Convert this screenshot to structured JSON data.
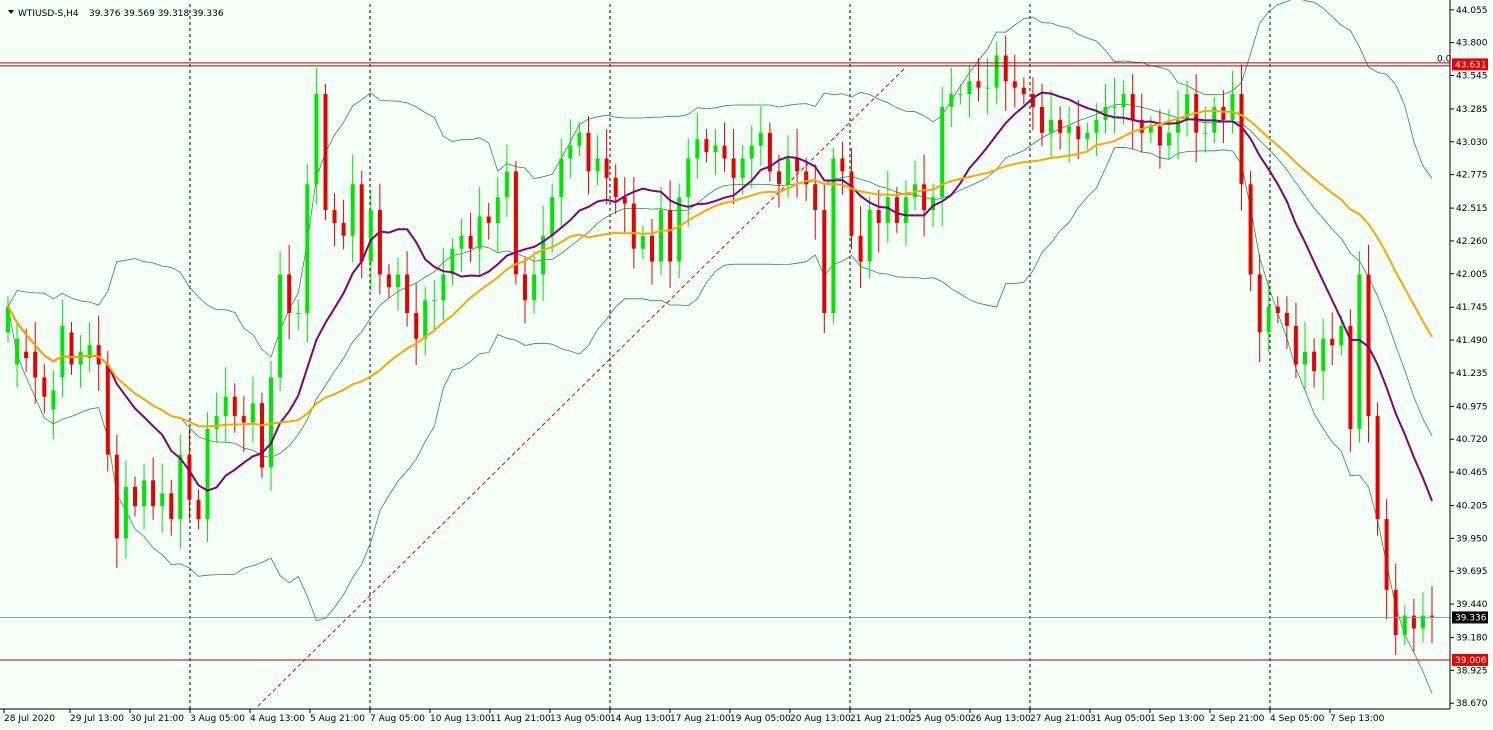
{
  "header": {
    "menu_arrow": "triangle-down-icon",
    "symbol": "WTIUSD-S,H4",
    "ohlc": "39.376 39.569 39.318 39.336"
  },
  "colors": {
    "background": "#f4fff7",
    "bull": "#00e600",
    "bear": "#e60000",
    "axis": "#000000",
    "bollinger": "#2e8b57",
    "ma_fast": "#800080",
    "ma_slow": "#ffa500",
    "level_line": "#c00000",
    "trend_line": "#e60000",
    "current_line": "#7a9aa3",
    "current_tag_bg": "#000000",
    "level_tag_bg": "#e60000"
  },
  "chart_data": {
    "type": "candlestick",
    "title": "WTIUSD-S,H4",
    "ylim": [
      38.625,
      44.1
    ],
    "y_ticks": [
      "44.055",
      "43.800",
      "43.545",
      "43.285",
      "43.030",
      "42.775",
      "42.515",
      "42.260",
      "42.005",
      "41.745",
      "41.490",
      "41.235",
      "40.975",
      "40.720",
      "40.465",
      "40.205",
      "39.950",
      "39.695",
      "39.440",
      "39.180",
      "38.925",
      "38.670"
    ],
    "x_ticks": [
      "28 Jul 2020",
      "29 Jul 13:00",
      "30 Jul 21:00",
      "3 Aug 05:00",
      "4 Aug 13:00",
      "5 Aug 21:00",
      "7 Aug 05:00",
      "10 Aug 13:00",
      "11 Aug 21:00",
      "13 Aug 05:00",
      "14 Aug 13:00",
      "17 Aug 21:00",
      "19 Aug 05:00",
      "20 Aug 13:00",
      "21 Aug 21:00",
      "25 Aug 05:00",
      "26 Aug 13:00",
      "27 Aug 21:00",
      "31 Aug 05:00",
      "1 Sep 13:00",
      "2 Sep 21:00",
      "4 Sep 05:00",
      "7 Sep 13:00"
    ],
    "period_separators": [
      "3 Aug 05:00",
      "7 Aug 05:00",
      "14 Aug 13:00",
      "21 Aug 21:00",
      "27 Aug 21:00",
      "4 Sep 05:00"
    ],
    "current_price": "39.336",
    "level_high": "43.631",
    "level_low": "39.006",
    "fib_label": "0.0",
    "close": [
      41.75,
      41.5,
      41.35,
      41.2,
      41.05,
      41.1,
      41.6,
      41.3,
      41.4,
      41.45,
      41.3,
      40.6,
      39.95,
      40.35,
      40.2,
      40.4,
      40.2,
      40.3,
      40.1,
      40.6,
      40.25,
      40.1,
      40.8,
      40.9,
      41.05,
      40.9,
      40.85,
      41.0,
      40.5,
      41.2,
      42.0,
      41.7,
      41.7,
      42.7,
      43.4,
      42.5,
      42.4,
      42.3,
      42.7,
      42.1,
      42.5,
      42.0,
      41.9,
      42.0,
      41.7,
      41.5,
      41.8,
      41.8,
      42.0,
      42.2,
      42.3,
      42.2,
      42.45,
      42.4,
      42.6,
      42.8,
      42.0,
      41.8,
      42.0,
      42.3,
      42.6,
      42.9,
      43.0,
      43.1,
      42.8,
      42.9,
      42.75,
      42.6,
      42.55,
      42.2,
      42.3,
      42.1,
      42.5,
      42.1,
      42.6,
      42.9,
      43.05,
      42.95,
      43.0,
      42.9,
      42.75,
      42.9,
      43.0,
      43.1,
      42.8,
      42.7,
      42.9,
      42.8,
      42.7,
      42.5,
      41.7,
      42.9,
      42.8,
      42.3,
      42.1,
      42.5,
      42.4,
      42.6,
      42.4,
      42.6,
      42.7,
      42.5,
      42.6,
      43.3,
      43.4,
      43.4,
      43.5,
      43.45,
      43.45,
      43.7,
      43.5,
      43.45,
      43.4,
      43.3,
      43.1,
      43.2,
      43.1,
      43.15,
      43.05,
      43.1,
      43.2,
      43.3,
      43.3,
      43.4,
      43.2,
      43.1,
      43.15,
      43.0,
      43.1,
      43.2,
      43.4,
      43.1,
      43.1,
      43.3,
      43.2,
      43.4,
      42.7,
      42.0,
      41.55,
      41.75,
      41.7,
      41.6,
      41.3,
      41.4,
      41.25,
      41.5,
      41.45,
      41.6,
      40.8,
      42.0,
      40.9,
      40.1,
      39.55,
      39.2,
      39.35,
      39.25,
      39.35,
      39.34
    ],
    "open": [
      41.55,
      41.3,
      41.4,
      41.4,
      41.2,
      40.95,
      41.2,
      41.55,
      41.3,
      41.35,
      41.45,
      41.3,
      40.6,
      39.95,
      40.35,
      40.2,
      40.4,
      40.2,
      40.3,
      40.1,
      40.6,
      40.25,
      40.1,
      40.8,
      40.9,
      41.05,
      40.9,
      40.85,
      41.0,
      40.5,
      41.2,
      42.0,
      41.7,
      41.7,
      42.7,
      43.4,
      42.5,
      42.4,
      42.3,
      42.7,
      42.1,
      42.5,
      42.0,
      41.9,
      42.0,
      41.7,
      41.5,
      41.8,
      41.8,
      42.0,
      42.2,
      42.3,
      42.2,
      42.45,
      42.4,
      42.6,
      42.8,
      42.0,
      41.8,
      42.0,
      42.3,
      42.6,
      42.9,
      43.0,
      43.1,
      42.8,
      42.9,
      42.75,
      42.6,
      42.55,
      42.2,
      42.3,
      42.1,
      42.5,
      42.1,
      42.6,
      42.9,
      43.05,
      42.95,
      43.0,
      42.9,
      42.75,
      42.9,
      43.0,
      43.1,
      42.8,
      42.7,
      42.9,
      42.8,
      42.7,
      42.5,
      41.7,
      42.9,
      42.8,
      42.3,
      42.1,
      42.5,
      42.4,
      42.6,
      42.4,
      42.6,
      42.7,
      42.5,
      42.6,
      43.3,
      43.4,
      43.4,
      43.5,
      43.45,
      43.45,
      43.7,
      43.5,
      43.45,
      43.4,
      43.3,
      43.1,
      43.2,
      43.1,
      43.15,
      43.05,
      43.1,
      43.2,
      43.3,
      43.3,
      43.4,
      43.2,
      43.1,
      43.15,
      43.0,
      43.1,
      43.2,
      43.4,
      43.1,
      43.1,
      43.3,
      43.2,
      43.4,
      42.7,
      42.0,
      41.55,
      41.75,
      41.7,
      41.6,
      41.3,
      41.4,
      41.25,
      41.5,
      41.45,
      41.6,
      40.8,
      42.0,
      40.9,
      40.1,
      39.55,
      39.2,
      39.35,
      39.25,
      39.35,
      39.376
    ]
  }
}
